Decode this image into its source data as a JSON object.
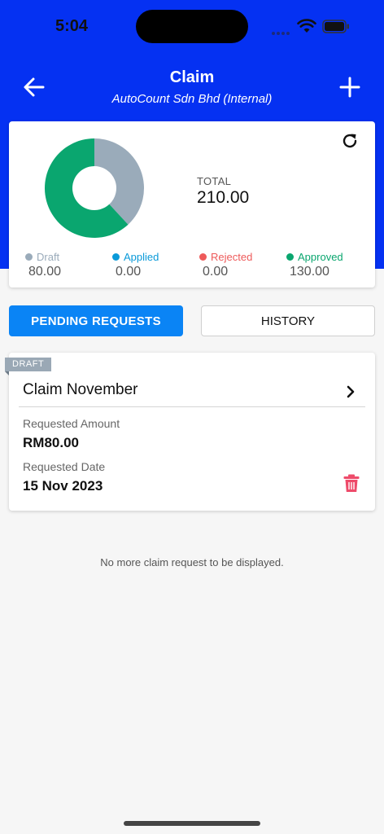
{
  "status_bar": {
    "time": "5:04"
  },
  "header": {
    "title": "Claim",
    "subtitle": "AutoCount Sdn Bhd (Internal)"
  },
  "summary": {
    "total_label": "TOTAL",
    "total_value": "210.00",
    "legend": [
      {
        "label": "Draft",
        "value": "80.00",
        "color": "#9aabba",
        "amount": 80
      },
      {
        "label": "Applied",
        "value": "0.00",
        "color": "#0a9ad9",
        "amount": 0
      },
      {
        "label": "Rejected",
        "value": "0.00",
        "color": "#ee5a5a",
        "amount": 0
      },
      {
        "label": "Approved",
        "value": "130.00",
        "color": "#0aa66f",
        "amount": 130
      }
    ]
  },
  "tabs": {
    "pending_label": "PENDING REQUESTS",
    "history_label": "HISTORY"
  },
  "claims": [
    {
      "status": "DRAFT",
      "title": "Claim November",
      "amount_label": "Requested Amount",
      "amount_value": "RM80.00",
      "date_label": "Requested Date",
      "date_value": "15 Nov 2023"
    }
  ],
  "empty_note": "No more claim request to be displayed.",
  "colors": {
    "header_bg": "#0531f2",
    "primary_button": "#0a84f5",
    "delete": "#ee4b6a"
  }
}
